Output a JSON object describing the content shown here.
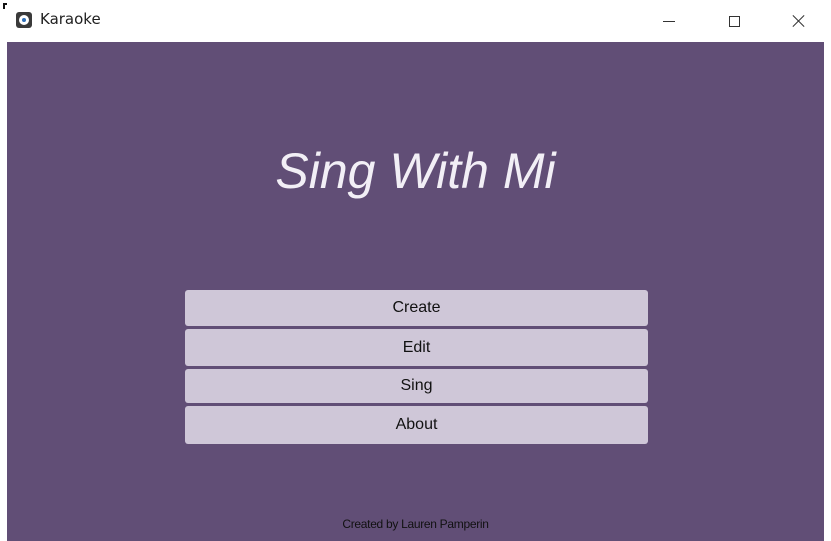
{
  "window": {
    "title": "Karaoke",
    "icon": "app-disc-icon"
  },
  "main": {
    "title": "Sing With Mi",
    "buttons": [
      {
        "label": "Create"
      },
      {
        "label": "Edit"
      },
      {
        "label": "Sing"
      },
      {
        "label": "About"
      }
    ],
    "credit": "Created by Lauren Pamperin"
  },
  "colors": {
    "background": "#614e76",
    "button": "#cfc7d8",
    "title_text": "#f2eff6"
  }
}
